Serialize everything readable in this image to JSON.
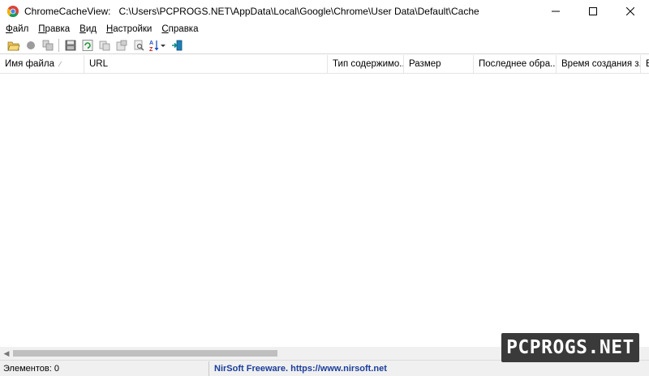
{
  "window": {
    "app_name": "ChromeCacheView:",
    "path": "C:\\Users\\PCPROGS.NET\\AppData\\Local\\Google\\Chrome\\User Data\\Default\\Cache"
  },
  "menu": {
    "items": [
      {
        "label": "Файл",
        "underline": "Ф",
        "rest": "айл"
      },
      {
        "label": "Правка",
        "underline": "П",
        "rest": "равка"
      },
      {
        "label": "Вид",
        "underline": "В",
        "rest": "ид"
      },
      {
        "label": "Настройки",
        "underline": "Н",
        "rest": "астройки"
      },
      {
        "label": "Справка",
        "underline": "С",
        "rest": "правка"
      }
    ]
  },
  "toolbar": {
    "icons": [
      "open-folder-icon",
      "stop-icon",
      "copy-files-icon",
      "save-icon",
      "refresh-icon",
      "copy-icon",
      "properties-icon",
      "find-icon",
      "sort-icon",
      "exit-icon"
    ]
  },
  "columns": [
    {
      "label": "Имя файла",
      "sorted": true
    },
    {
      "label": "URL"
    },
    {
      "label": "Тип содержимо..."
    },
    {
      "label": "Размер"
    },
    {
      "label": "Последнее обра..."
    },
    {
      "label": "Время создания з..."
    },
    {
      "label": "В"
    }
  ],
  "status": {
    "count": "Элементов: 0",
    "credit": "NirSoft Freeware. https://www.nirsoft.net"
  },
  "watermark": "PCPROGS.NET",
  "colors": {
    "credit_text": "#1a3e9a",
    "watermark_bg": "#3a3a3a"
  }
}
